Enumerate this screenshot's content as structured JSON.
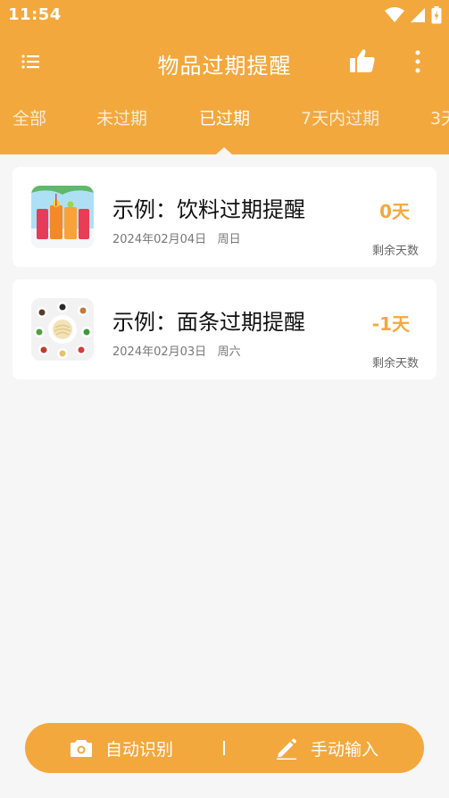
{
  "status_bar": {
    "time": "11:54"
  },
  "app_bar": {
    "title": "物品过期提醒"
  },
  "tabs": [
    {
      "label": "全部",
      "active": false
    },
    {
      "label": "未过期",
      "active": false
    },
    {
      "label": "已过期",
      "active": true
    },
    {
      "label": "7天内过期",
      "active": false
    },
    {
      "label": "3天",
      "active": false
    }
  ],
  "items": [
    {
      "title": "示例：饮料过期提醒",
      "date": "2024年02月04日",
      "weekday": "周日",
      "days": "0天",
      "days_label": "剩余天数",
      "thumb_icon": "drinks-image"
    },
    {
      "title": "示例：面条过期提醒",
      "date": "2024年02月03日",
      "weekday": "周六",
      "days": "-1天",
      "days_label": "剩余天数",
      "thumb_icon": "noodles-image"
    }
  ],
  "bottom_actions": {
    "auto_label": "自动识别",
    "manual_label": "手动输入"
  },
  "colors": {
    "accent": "#f3a83d",
    "background": "#f6f6f6"
  }
}
